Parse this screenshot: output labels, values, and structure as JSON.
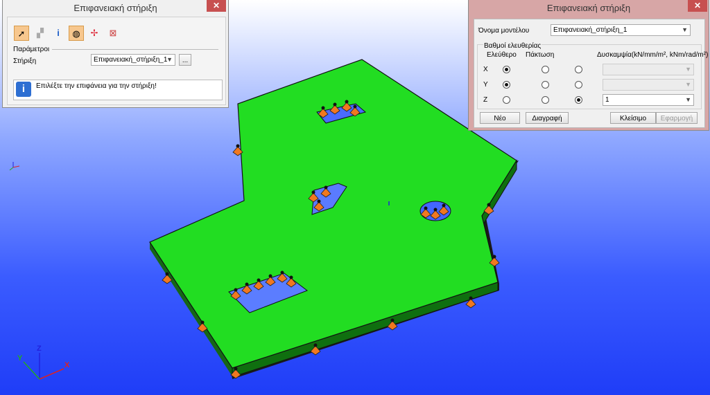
{
  "left_dialog": {
    "title": "Επιφανειακή στήριξη",
    "params_label": "Παράμετροι",
    "support_label": "Στήριξη",
    "support_value": "Επιφανειακή_στήριξη_1",
    "browse_label": "...",
    "info_text": "Επιλέξτε την επιφάνεια για την στήριξη!",
    "info_icon_text": "i",
    "close_glyph": "✕"
  },
  "right_dialog": {
    "title": "Επιφανειακή στήριξη",
    "model_name_label": "Όνομα μοντέλου",
    "model_name_value": "Επιφανειακή_στήριξη_1",
    "dof_label": "Βαθμοί ελευθερίας",
    "col_free": "Ελεύθερο",
    "col_fixed": "Πάκτωση",
    "col_stiffness": "Δυσκαμψία(kN/mm/m², kNm/rad/m²)",
    "row_x": "X",
    "row_y": "Y",
    "row_z": "Z",
    "z_stiffness_value": "1",
    "btn_new": "Νέο",
    "btn_delete": "Διαγραφή",
    "btn_close": "Κλείσιμο",
    "btn_apply": "Εφαρμογή",
    "close_glyph": "✕",
    "dof_state": {
      "x": "free",
      "y": "free",
      "z": "stiffness"
    }
  },
  "axes": {
    "x": "X",
    "y": "Y",
    "z": "Z"
  },
  "colors": {
    "slab": "#22dd22",
    "support": "#f07820",
    "close_red": "#c75050",
    "info_blue": "#2e6fd2"
  }
}
